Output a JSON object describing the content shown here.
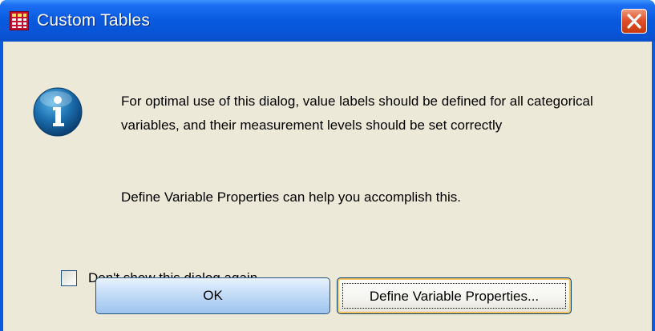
{
  "window": {
    "title": "Custom Tables",
    "app_icon": "table-grid-icon",
    "close_icon": "close-icon",
    "accent_color": "#0a5be0"
  },
  "dialog": {
    "icon": "info-icon",
    "message": "For optimal use of this dialog, value labels should be defined for all categorical variables, and their measurement levels should be set correctly",
    "hint": "Define Variable Properties can help you accomplish this.",
    "checkbox": {
      "label": "Don't show this dialog again",
      "checked": false
    },
    "buttons": {
      "ok": "OK",
      "define": "Define Variable Properties..."
    }
  }
}
